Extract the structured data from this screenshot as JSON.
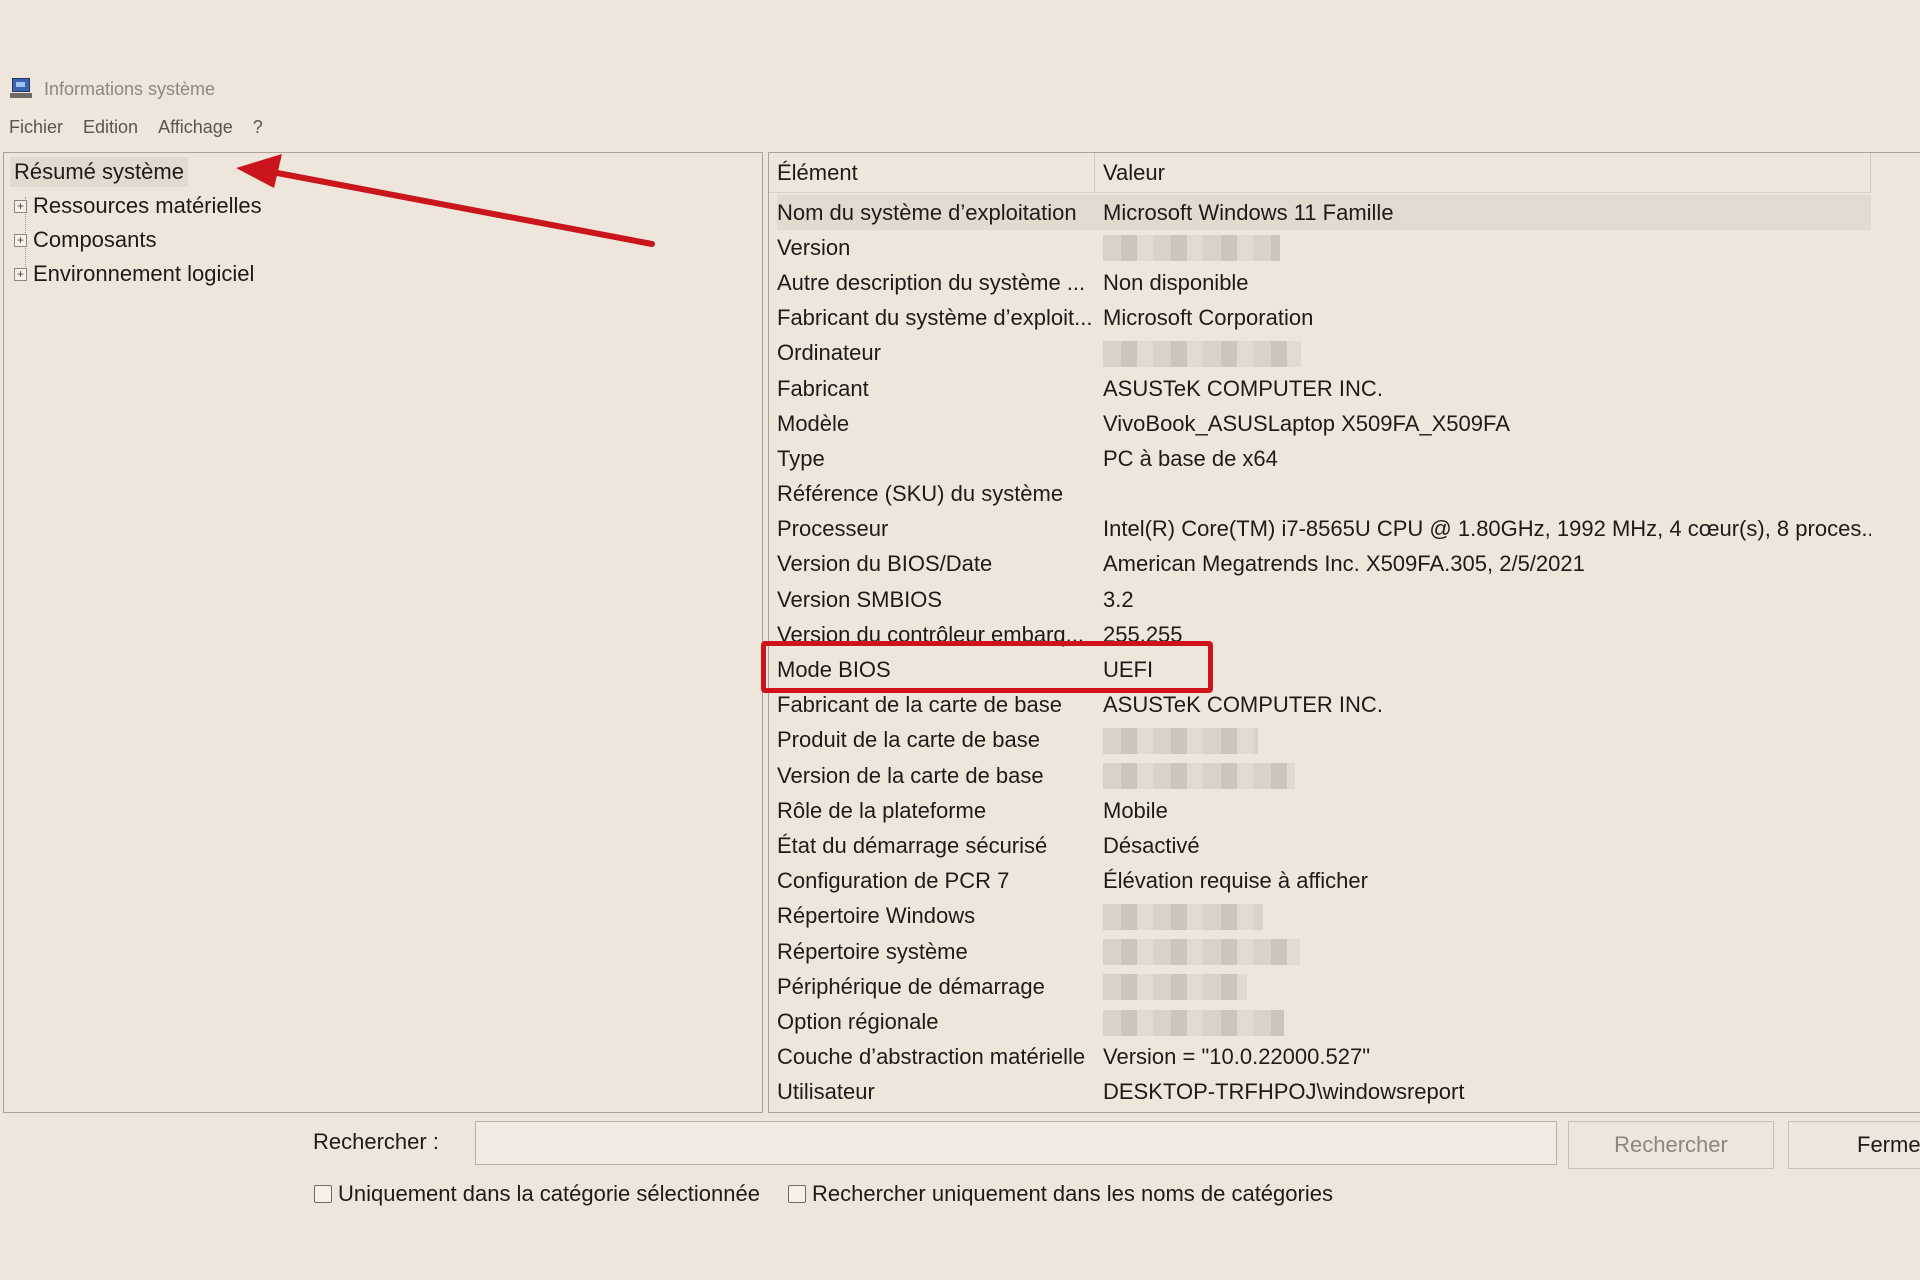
{
  "window": {
    "title": "Informations système"
  },
  "menu": [
    "Fichier",
    "Edition",
    "Affichage",
    "?"
  ],
  "tree": {
    "root": "Résumé système",
    "items": [
      "Ressources matérielles",
      "Composants",
      "Environnement logiciel"
    ],
    "expander_symbol": "+"
  },
  "table": {
    "headers": [
      "Élément",
      "Valeur"
    ],
    "rows": [
      {
        "element": "Nom du système d’exploitation",
        "value": "Microsoft Windows 11 Famille",
        "selected": true
      },
      {
        "element": "Version",
        "value": "",
        "redacted": true
      },
      {
        "element": "Autre description du système ...",
        "value": "Non disponible"
      },
      {
        "element": "Fabricant du système d’exploit...",
        "value": "Microsoft Corporation"
      },
      {
        "element": "Ordinateur",
        "value": "",
        "redacted": true
      },
      {
        "element": "Fabricant",
        "value": "ASUSTeK COMPUTER INC."
      },
      {
        "element": "Modèle",
        "value": "VivoBook_ASUSLaptop X509FA_X509FA"
      },
      {
        "element": "Type",
        "value": "PC à base de x64"
      },
      {
        "element": "Référence (SKU) du système",
        "value": ""
      },
      {
        "element": "Processeur",
        "value": "Intel(R) Core(TM) i7-8565U CPU @ 1.80GHz, 1992 MHz, 4 cœur(s), 8 proces..."
      },
      {
        "element": "Version du BIOS/Date",
        "value": "American Megatrends Inc. X509FA.305, 2/5/2021"
      },
      {
        "element": "Version SMBIOS",
        "value": "3.2"
      },
      {
        "element": "Version du contrôleur embarq...",
        "value": "255.255"
      },
      {
        "element": "Mode BIOS",
        "value": "UEFI",
        "highlighted": true
      },
      {
        "element": "Fabricant de la carte de base",
        "value": "ASUSTeK COMPUTER INC."
      },
      {
        "element": "Produit de la carte de base",
        "value": "",
        "redacted": true
      },
      {
        "element": "Version de la carte de base",
        "value": "",
        "redacted": true
      },
      {
        "element": "Rôle de la plateforme",
        "value": "Mobile"
      },
      {
        "element": "État du démarrage sécurisé",
        "value": "Désactivé"
      },
      {
        "element": "Configuration de PCR 7",
        "value": "Élévation requise à afficher"
      },
      {
        "element": "Répertoire Windows",
        "value": "",
        "redacted": true
      },
      {
        "element": "Répertoire système",
        "value": "",
        "redacted": true
      },
      {
        "element": "Périphérique de démarrage",
        "value": "",
        "redacted": true
      },
      {
        "element": "Option régionale",
        "value": "",
        "redacted": true
      },
      {
        "element": "Couche d’abstraction matérielle",
        "value": "Version = \"10.0.22000.527\""
      },
      {
        "element": "Utilisateur",
        "value": "DESKTOP-TRFHPOJ\\windowsreport"
      }
    ]
  },
  "search": {
    "label": "Rechercher :",
    "value": "",
    "search_button": "Rechercher",
    "close_button": "Ferme",
    "option1": "Uniquement dans la catégorie sélectionnée",
    "option2": "Rechercher uniquement dans les noms de catégories"
  },
  "colors": {
    "background": "#efe6db",
    "annotation_red": "#d0131a",
    "selection": "#e2d9cf"
  }
}
